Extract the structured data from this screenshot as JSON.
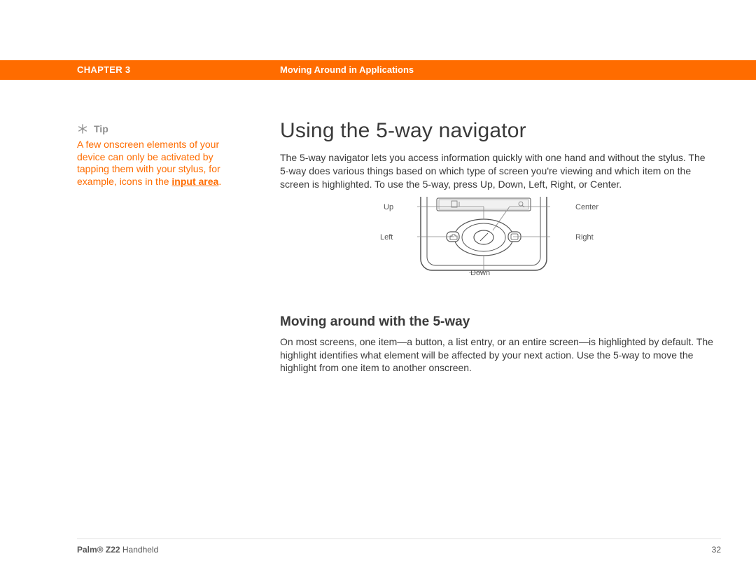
{
  "header": {
    "chapter": "CHAPTER 3",
    "breadcrumb": "Moving Around in Applications"
  },
  "sidebar": {
    "tip_label": "Tip",
    "tip_text": "A few onscreen elements of your device can only be activated by tapping them with your stylus, for example, icons in the ",
    "tip_link": "input area",
    "tip_suffix": "."
  },
  "main": {
    "heading": "Using the 5-way navigator",
    "paragraph1": "The 5-way navigator lets you access information quickly with one hand and without the stylus. The 5-way does various things based on which type of screen you're viewing and which item on the screen is highlighted. To use the 5-way, press Up, Down, Left, Right, or Center.",
    "labels": {
      "up": "Up",
      "down": "Down",
      "left": "Left",
      "right": "Right",
      "center": "Center"
    },
    "subheading": "Moving around with the 5-way",
    "paragraph2": "On most screens, one item—a button, a list entry, or an entire screen—is highlighted by default. The highlight identifies what element will be affected by your next action. Use the 5-way to move the highlight from one item to another onscreen."
  },
  "footer": {
    "product_bold": "Palm® Z22",
    "product_rest": " Handheld",
    "page": "32"
  }
}
